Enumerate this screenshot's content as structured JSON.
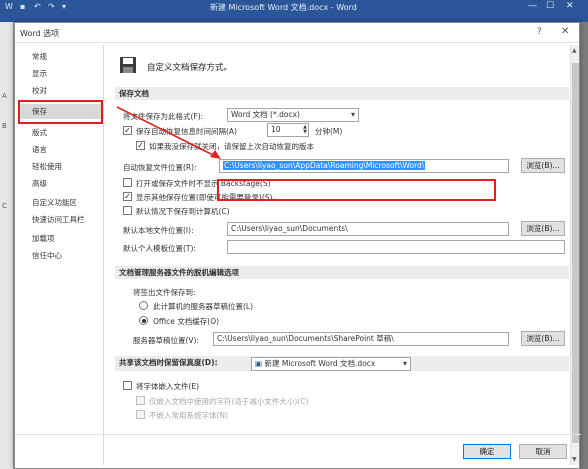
{
  "titlebar": {
    "title": "新建 Microsoft Word 文档.docx  -  Word",
    "minimize": "—",
    "restore": "☐",
    "close": "✕"
  },
  "dialog": {
    "title": "Word 选项",
    "help": "?",
    "close": "✕"
  },
  "nav": {
    "items": [
      {
        "label": "常规"
      },
      {
        "label": "显示"
      },
      {
        "label": "校对"
      },
      {
        "label": "保存",
        "selected": true
      },
      {
        "label": "版式"
      },
      {
        "label": "语言"
      },
      {
        "label": "轻松使用"
      },
      {
        "label": "高级"
      },
      {
        "label": "自定义功能区"
      },
      {
        "label": "快速访问工具栏"
      },
      {
        "label": "加载项"
      },
      {
        "label": "信任中心"
      }
    ]
  },
  "header": {
    "text": "自定义文档保存方式。",
    "icon": "save-icon"
  },
  "save_docs": {
    "section_title": "保存文档",
    "format_label": "将文件保存为此格式(F):",
    "format_value": "Word 文档 (*.docx)",
    "autorecover_label": "保存自动恢复信息时间间隔(A)",
    "autorecover_minutes": "10",
    "minutes_label": "分钟(M)",
    "keep_last_label": "如果我没保存就关闭，请保留上次自动恢复的版本",
    "autorecover_path_label": "自动恢复文件位置(R):",
    "autorecover_path_value": "C:\\Users\\liyao_sun\\AppData\\Roaming\\Microsoft\\Word\\",
    "browse": "浏览(B)...",
    "no_backstage_label": "打开或保存文件时不显示 Backstage(S)",
    "show_more_label": "显示其他保存位置(即使可能需要登录)(S)。",
    "default_computer_label": "默认情况下保存到计算机(C)",
    "default_local_label": "默认本地文件位置(I):",
    "default_local_value": "C:\\Users\\liyao_sun\\Documents\\",
    "template_label": "默认个人模板位置(T):",
    "template_value": ""
  },
  "offline": {
    "section_title": "文档管理服务器文件的脱机编辑选项",
    "checkout_label": "将签出文件保存到:",
    "radio_server": "此计算机的服务器草稿位置(L)",
    "radio_cache": "Office 文档缓存(O)",
    "drafts_label": "服务器草稿位置(V):",
    "drafts_value": "C:\\Users\\liyao_sun\\Documents\\SharePoint 草稿\\",
    "browse": "浏览(B)..."
  },
  "fidelity": {
    "section_title": "共享该文档时保留保真度(D):",
    "doc_value": "新建 Microsoft Word 文档.docx",
    "embed_fonts_label": "将字体嵌入文件(E)",
    "embed_used_label": "仅嵌入文档中使用的字符(适于减小文件大小)(C)",
    "no_common_label": "不嵌入常用系统字体(N)"
  },
  "footer": {
    "ok": "确定",
    "cancel": "取消"
  },
  "colors": {
    "title_bar": "#2b579a",
    "highlight": "#e02020",
    "selection": "#3390ff"
  }
}
